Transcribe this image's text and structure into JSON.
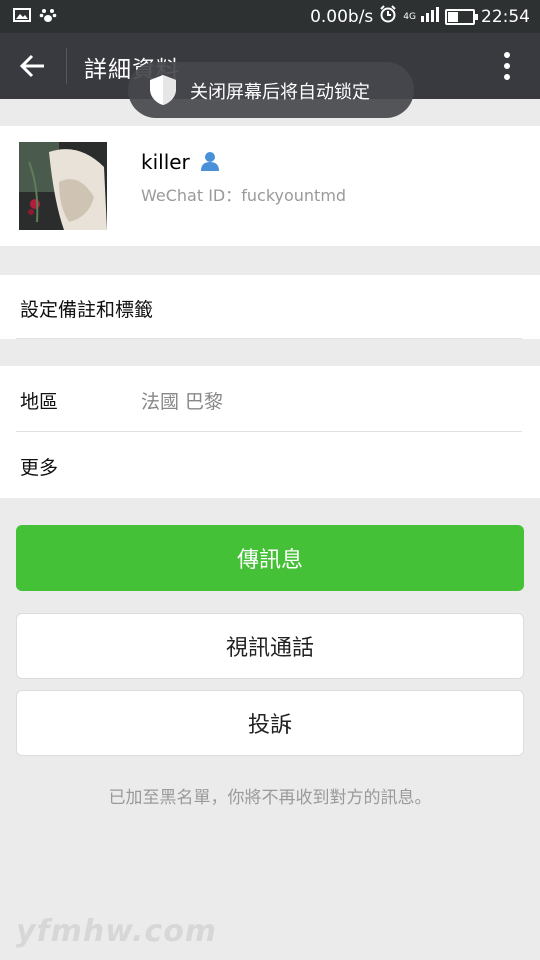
{
  "status_bar": {
    "speed": "0.00b/s",
    "network": "4G",
    "time": "22:54",
    "battery_level": 0.45
  },
  "toolbar": {
    "title": "詳細資料"
  },
  "toast": {
    "text": "关闭屏幕后将自动锁定"
  },
  "profile": {
    "nickname": "killer",
    "wechat_id": "WeChat ID：fuckyountmd"
  },
  "remark_row": {
    "label": "設定備註和標籤"
  },
  "region_row": {
    "label": "地區",
    "value": "法國  巴黎"
  },
  "more_row": {
    "label": "更多"
  },
  "buttons": {
    "send_message": "傳訊息",
    "video_call": "視訊通話",
    "report": "投訴"
  },
  "notice": "已加至黑名單，你將不再收到對方的訊息。",
  "watermark": "yfmhw.com",
  "colors": {
    "toolbar": "#393a3f",
    "status_bar": "#2e3132",
    "primary": "#44c136",
    "background": "#ebebeb"
  }
}
